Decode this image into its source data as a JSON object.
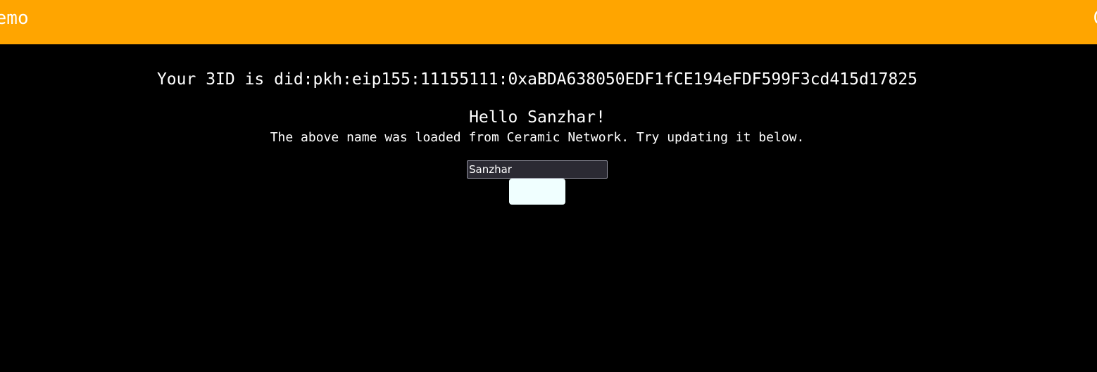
{
  "header": {
    "title": "Demo",
    "edge_text": "C"
  },
  "main": {
    "did_text": "Your 3ID is did:pkh:eip155:11155111:0xaBDA638050EDF1fCE194eFDF599F3cd415d17825",
    "greeting": "Hello Sanzhar!",
    "note": "The above name was loaded from Ceramic Network. Try updating it below.",
    "name_input_value": "Sanzhar",
    "submit_label": ""
  },
  "colors": {
    "header_background": "#ffa500",
    "page_background": "#000000",
    "text": "#ffffff",
    "input_background": "#2b2a33",
    "button_background": "#f0ffff"
  }
}
